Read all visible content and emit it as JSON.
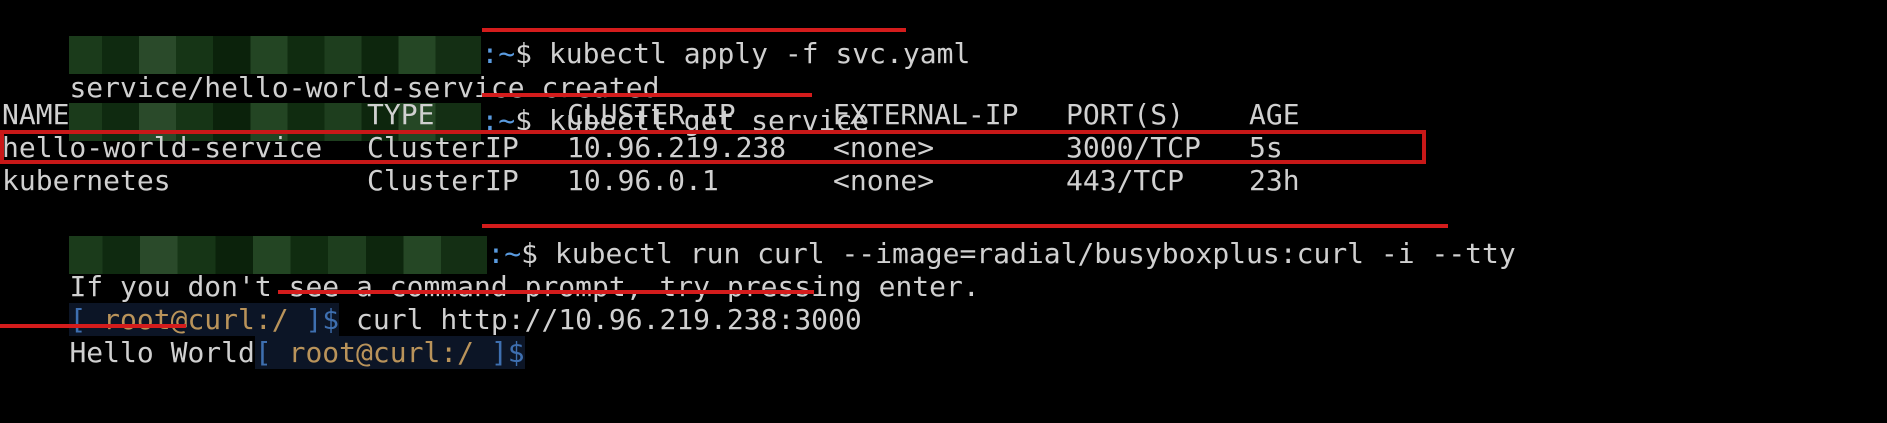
{
  "prompt": {
    "path": ":~",
    "symbol": "$"
  },
  "line1": {
    "command": " kubectl apply -f svc.yaml"
  },
  "line2": {
    "output": "service/hello-world-service created"
  },
  "line3": {
    "command": " kubectl get service"
  },
  "table": {
    "headers": [
      "NAME",
      "TYPE",
      "CLUSTER-IP",
      "EXTERNAL-IP",
      "PORT(S)",
      "AGE"
    ],
    "rows": [
      [
        "hello-world-service",
        "ClusterIP",
        "10.96.219.238",
        "<none>",
        "3000/TCP",
        "5s"
      ],
      [
        "kubernetes",
        "ClusterIP",
        "10.96.0.1",
        "<none>",
        "443/TCP",
        "23h"
      ]
    ]
  },
  "line7": {
    "command": " kubectl run curl --image=radial/busyboxplus:curl -i --tty"
  },
  "line8": {
    "output": "If you don't see a command prompt, try pressing enter."
  },
  "container_prompt": {
    "open": "[ ",
    "user": "root@curl:/",
    "close": " ]$"
  },
  "line9": {
    "command": " curl http://10.96.219.238:3000"
  },
  "line10": {
    "output": "Hello World"
  },
  "colors": {
    "highlight": "#c81818",
    "path": "#5a9be0",
    "text": "#d0d0d0",
    "background": "#000000"
  }
}
